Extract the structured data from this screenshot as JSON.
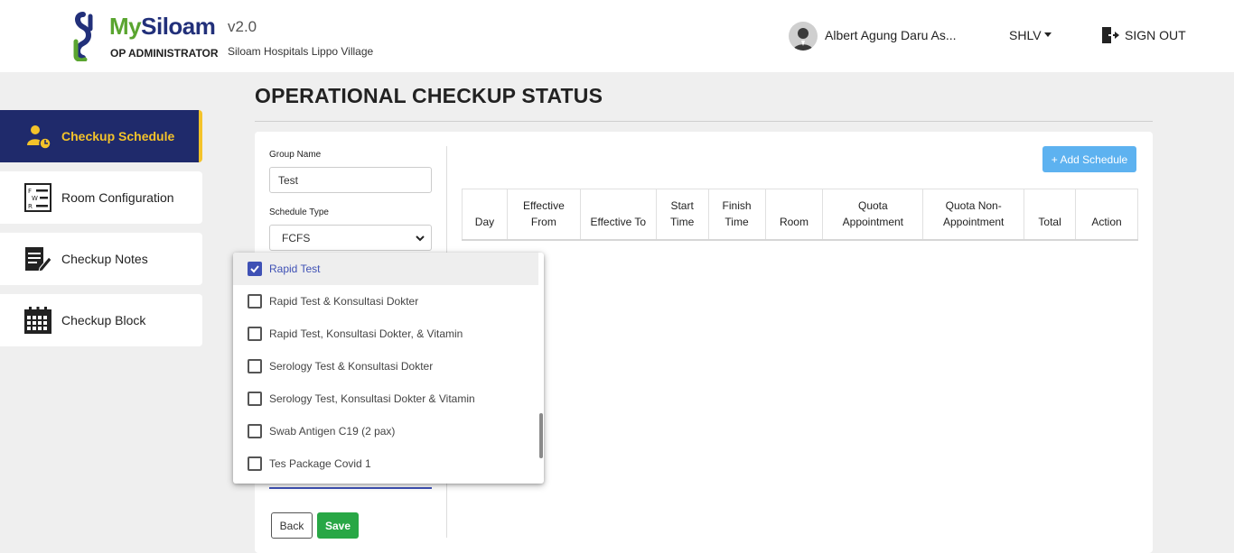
{
  "header": {
    "brand_my": "My",
    "brand_siloam": "Siloam",
    "version": "v2.0",
    "role": "OP ADMINISTRATOR",
    "hospital": "Siloam Hospitals Lippo Village",
    "user_name": "Albert Agung Daru As...",
    "site_code": "SHLV",
    "sign_out": "SIGN OUT"
  },
  "sidebar": {
    "items": [
      {
        "label": "Checkup Schedule",
        "icon": "doctor-clock-icon",
        "active": true
      },
      {
        "label": "Room Configuration",
        "icon": "fwr-list-icon",
        "active": false
      },
      {
        "label": "Checkup Notes",
        "icon": "notes-pencil-icon",
        "active": false
      },
      {
        "label": "Checkup Block",
        "icon": "calendar-icon",
        "active": false
      }
    ]
  },
  "page": {
    "title": "OPERATIONAL CHECKUP STATUS"
  },
  "form": {
    "group_name_label": "Group Name",
    "group_name_value": "Test",
    "schedule_type_label": "Schedule Type",
    "schedule_type_value": "FCFS",
    "back_label": "Back",
    "save_label": "Save"
  },
  "packages": {
    "options": [
      {
        "label": "Rapid Test",
        "checked": true
      },
      {
        "label": "Rapid Test & Konsultasi Dokter",
        "checked": false
      },
      {
        "label": "Rapid Test, Konsultasi Dokter, & Vitamin",
        "checked": false
      },
      {
        "label": "Serology Test & Konsultasi Dokter",
        "checked": false
      },
      {
        "label": "Serology Test, Konsultasi Dokter & Vitamin",
        "checked": false
      },
      {
        "label": "Swab Antigen C19 (2 pax)",
        "checked": false
      },
      {
        "label": "Tes Package Covid 1",
        "checked": false
      }
    ]
  },
  "schedule": {
    "add_label": "+ Add Schedule",
    "columns": [
      "Day",
      "Effective From",
      "Effective To",
      "Start Time",
      "Finish Time",
      "Room",
      "Quota Appointment",
      "Quota Non-Appointment",
      "Total",
      "Action"
    ]
  },
  "colors": {
    "brand_green": "#5aa530",
    "brand_navy": "#22307a",
    "sidebar_active_bg": "#1f2a6b",
    "sidebar_active_text": "#f4c32a",
    "add_button": "#5db2f0",
    "save_button": "#28a745",
    "checkbox_accent": "#3f51b5"
  }
}
